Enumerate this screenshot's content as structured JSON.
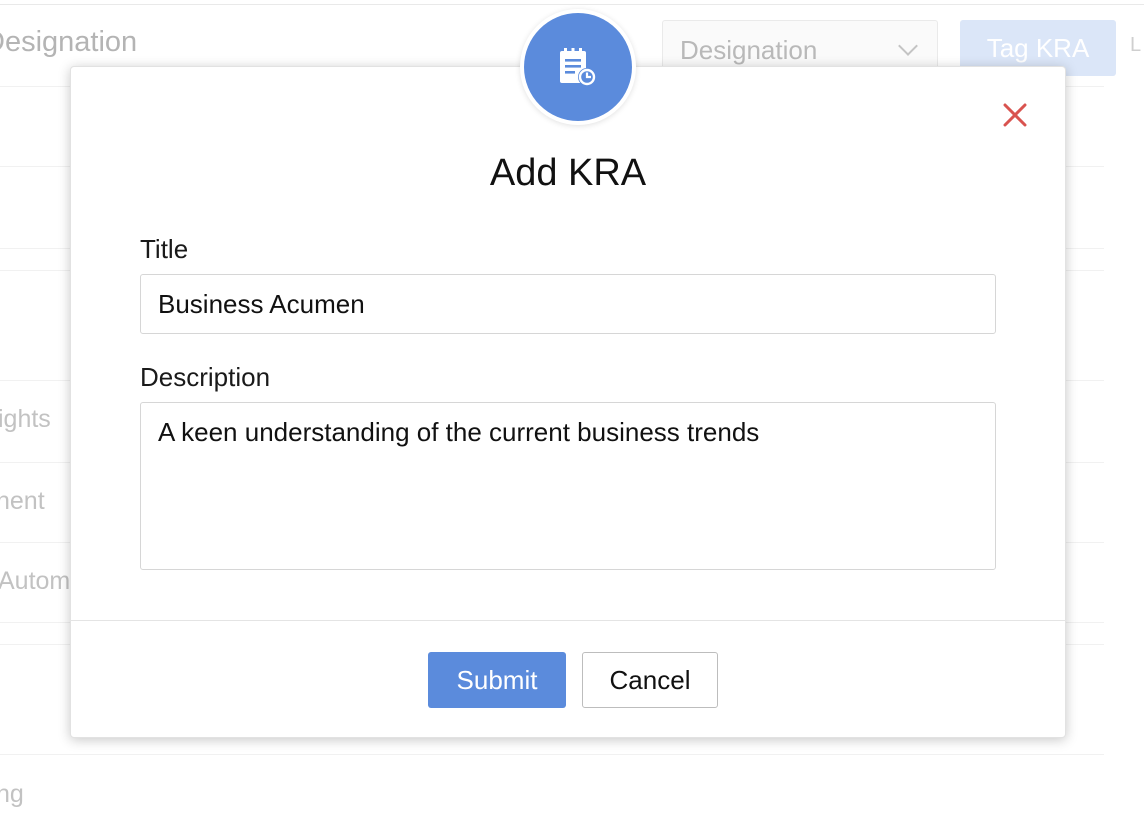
{
  "background": {
    "heading": "Designation",
    "designation_select": {
      "selected": "Designation",
      "icon": "chevron-down-icon"
    },
    "tag_kra_button": "Tag KRA",
    "edge_char": "L",
    "rows": [
      "ights",
      "nent",
      "Autom",
      "ng"
    ]
  },
  "modal": {
    "badge_icon": "kra-document-clock-icon",
    "close_icon": "close-icon",
    "title": "Add KRA",
    "title_field": {
      "label": "Title",
      "value": "Business Acumen"
    },
    "description_field": {
      "label": "Description",
      "value": "A keen understanding of the current business trends"
    },
    "submit_label": "Submit",
    "cancel_label": "Cancel"
  },
  "colors": {
    "accent": "#5b8bdc",
    "close": "#d9534f",
    "faded_button": "#dbe6f8"
  }
}
